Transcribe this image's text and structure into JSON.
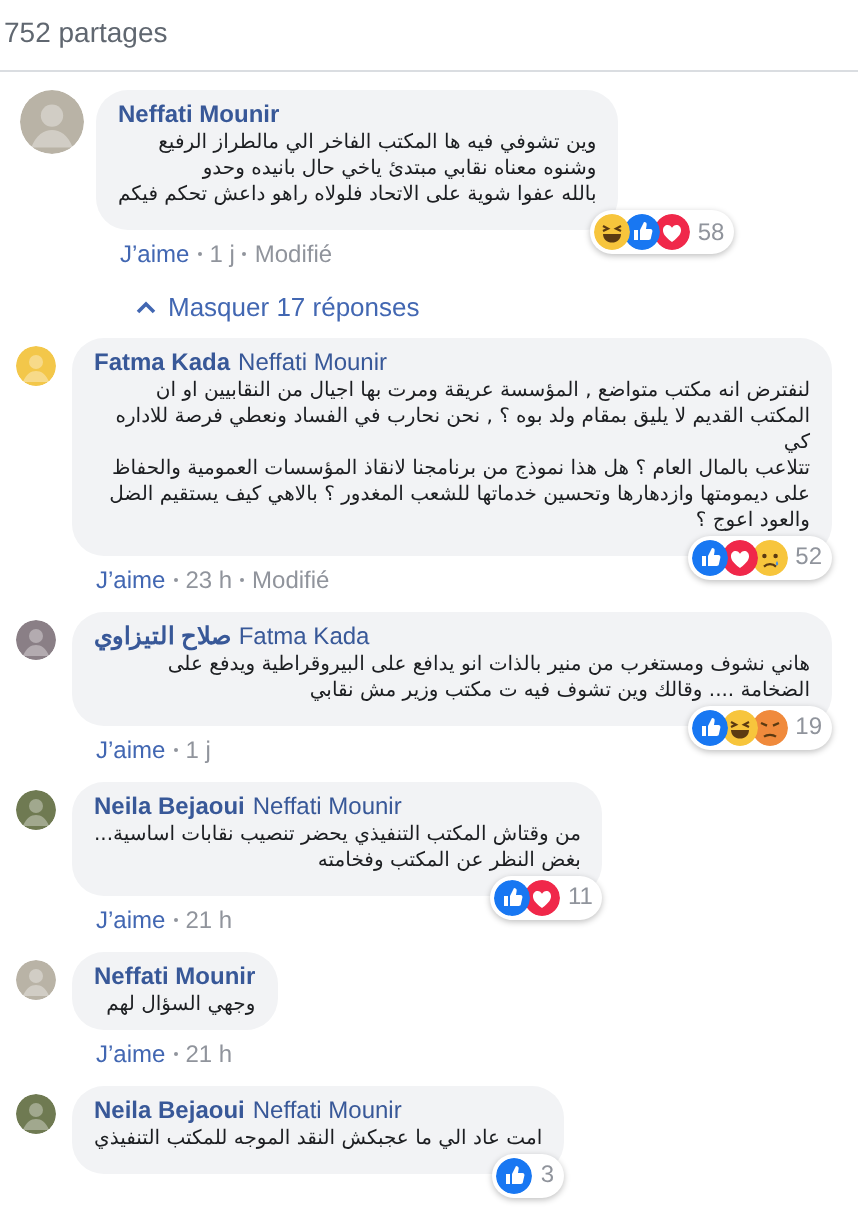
{
  "share_count": "752 partages",
  "comment": {
    "author": "Neffati Mounir",
    "text": "وين تشوفي فيه ها المكتب الفاخر الي مالطراز الرفيع\nوشنوه معناه نقابي مبتدئ ياخي حال بانيده وحدو\nبالله عفوا شوية على الاتحاد فلولاه راهو داعش تحكم فيكم",
    "reactions": [
      {
        "kind": "haha"
      },
      {
        "kind": "like"
      },
      {
        "kind": "love"
      }
    ],
    "reaction_count": "58",
    "like_label": "J’aime",
    "time": "1 j",
    "edited": "Modifié"
  },
  "replies_toggle": "Masquer 17 réponses",
  "replies": [
    {
      "author": "Fatma Kada",
      "mention": "Neffati Mounir",
      "text": "لنفترض انه مكتب متواضع , المؤسسة عريقة ومرت بها اجيال من النقابيين او ان المكتب القديم لا يليق بمقام ولد بوه ؟ , نحن نحارب في الفساد ونعطي فرصة للاداره كي\nتتلاعب بالمال العام ؟ هل هذا نموذج من برنامجنا لانقاذ المؤسسات العمومية والحفاظ على ديمومتها وازدهارها وتحسين خدماتها للشعب المغدور ؟ بالاهي كيف يستقيم الضل والعود اعوج ؟",
      "reactions": [
        {
          "kind": "like"
        },
        {
          "kind": "love"
        },
        {
          "kind": "sad"
        }
      ],
      "reaction_count": "52",
      "like_label": "J’aime",
      "time": "23 h",
      "edited": "Modifié"
    },
    {
      "author": "صلاح التيزاوي",
      "mention": "Fatma Kada",
      "text": "هاني نشوف ومستغرب من منير بالذات انو يدافع على البيروقراطية ويدفع على الضخامة .... وقالك وين تشوف فيه ت مكتب وزير مش نقابي",
      "reactions": [
        {
          "kind": "like"
        },
        {
          "kind": "haha"
        },
        {
          "kind": "angry"
        }
      ],
      "reaction_count": "19",
      "like_label": "J’aime",
      "time": "1 j"
    },
    {
      "author": "Neila Bejaoui",
      "mention": "Neffati Mounir",
      "text": "من وقتاش المكتب التنفيذي يحضر تنصيب نقابات اساسية...\nبغض النظر عن المكتب وفخامته",
      "reactions": [
        {
          "kind": "like"
        },
        {
          "kind": "love"
        }
      ],
      "reaction_count": "11",
      "like_label": "J’aime",
      "time": "21 h"
    },
    {
      "author": "Neffati Mounir",
      "text": "وجهي السؤال لهم",
      "like_label": "J’aime",
      "time": "21 h"
    },
    {
      "author": "Neila Bejaoui",
      "mention": "Neffati Mounir",
      "text": "امت عاد الي ما عجبكش النقد الموجه للمكتب التنفيذي",
      "reactions": [
        {
          "kind": "like"
        }
      ],
      "reaction_count": "3"
    }
  ]
}
